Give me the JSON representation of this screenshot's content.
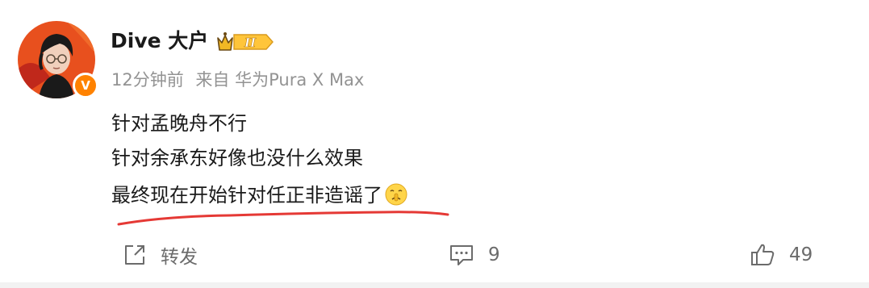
{
  "post": {
    "author": {
      "name": "Dive 大户",
      "verified_badge": "V",
      "level_badge": "II"
    },
    "meta": {
      "time": "12分钟前",
      "source": "来自 华为Pura X Max"
    },
    "content_lines": [
      "针对孟晚舟不行",
      "针对余承东好像也没什么效果",
      "最终现在开始针对任正非造谣了"
    ],
    "emoji": "shushing-face-icon"
  },
  "actions": {
    "repost_label": "转发",
    "comment_count": "9",
    "like_count": "49"
  },
  "colors": {
    "accent_orange": "#ff8200",
    "underline_red": "#e53935",
    "meta_gray": "#939393",
    "text_dark": "#1a1a1a"
  }
}
